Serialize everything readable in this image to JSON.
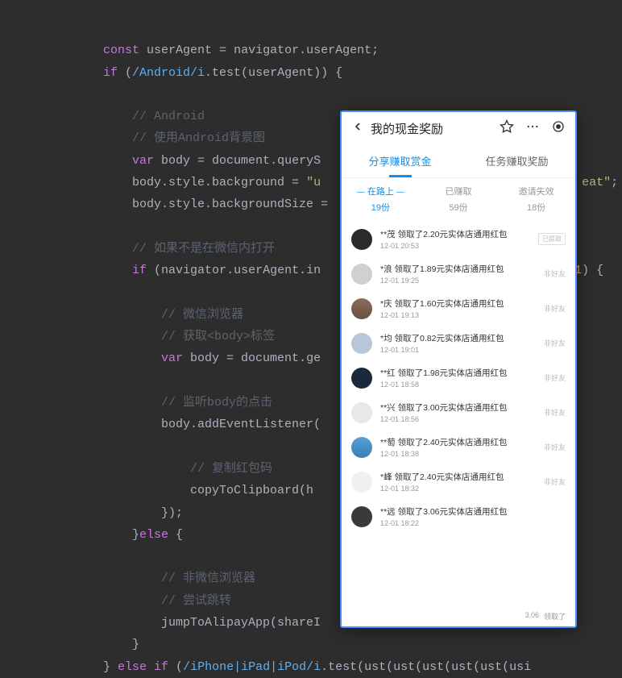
{
  "code": {
    "l1": {
      "const": "const",
      "userAgent": "userAgent",
      "eq": " = ",
      "nav": "navigator",
      "dot": ".",
      "ua": "userAgent",
      "semi": ";"
    },
    "l2": {
      "if": "if",
      "lp": " (",
      "regex": "/Android/i",
      "test": ".test(",
      "ua": "userAgent",
      "rp": ")) {"
    },
    "c1": "// Android",
    "c2": "// 使用Android背景图",
    "l5": {
      "var": "var",
      "body": " body = ",
      "doc": "document",
      "dot": ".",
      "qs": "queryS"
    },
    "l6": {
      "body": "body",
      "sb": ".style.background = ",
      "str": "\"u",
      "str2": "eat\"",
      "semi": ";"
    },
    "l7": {
      "body": "body",
      "sbs": ".style.backgroundSize ="
    },
    "c3": "// 如果不是在微信内打开",
    "l9": {
      "if": "if",
      "lp": " (",
      "nav": "navigator",
      "ua": ".userAgent.in",
      "num": "1",
      "rp": ") {"
    },
    "c4": "// 微信浏览器",
    "c5": "// 获取<body>标签",
    "l12": {
      "var": "var",
      "body": " body = ",
      "doc": "document",
      "ge": ".ge"
    },
    "c6": "// 监听body的点击",
    "l14": {
      "body": "body",
      "ael": ".addEventListener("
    },
    "c7": "// 复制红包码",
    "l16": {
      "ctc": "copyToClipboard(h"
    },
    "l17": {
      "brace": "})",
      "semi": ";"
    },
    "l18": {
      "rbrace": "}",
      "else": "else",
      "lbrace": " {"
    },
    "c8": "// 非微信浏览器",
    "c9": "// 尝试跳转",
    "l21": {
      "jta": "jumpToAlipayApp(shareI"
    },
    "l22": "}",
    "l23": {
      "rbrace": "} ",
      "else": "else",
      "if": " if",
      "lp": " (",
      "regex": "/iPhone|iPad|iPod/i",
      "tail": ".test(ust(ust(ust(ust(ust(usi"
    }
  },
  "phone": {
    "header": {
      "title": "我的现金奖励"
    },
    "tabs": [
      {
        "label": "分享赚取赏金",
        "active": true
      },
      {
        "label": "任务赚取奖励",
        "active": false
      }
    ],
    "status": [
      {
        "label": "在路上",
        "count": "19份",
        "active": true
      },
      {
        "label": "已赚取",
        "count": "59份",
        "active": false
      },
      {
        "label": "邀请失效",
        "count": "18份",
        "active": false
      }
    ],
    "rewards": [
      {
        "name": "**茂 领取了2.20元实体店通用红包",
        "time": "12-01 20:53",
        "badge": "已提取",
        "avatar": "c1"
      },
      {
        "name": "*浪 领取了1.89元实体店通用红包",
        "time": "12-01 19:25",
        "tag": "非好友",
        "avatar": "c2"
      },
      {
        "name": "*庆 领取了1.60元实体店通用红包",
        "time": "12-01 19:13",
        "tag": "非好友",
        "avatar": "c3"
      },
      {
        "name": "*均 领取了0.82元实体店通用红包",
        "time": "12-01 19:01",
        "tag": "非好友",
        "avatar": "c4"
      },
      {
        "name": "**红 领取了1.98元实体店通用红包",
        "time": "12-01 18:58",
        "tag": "非好友",
        "avatar": "c5"
      },
      {
        "name": "**兴 领取了3.00元实体店通用红包",
        "time": "12-01 18:56",
        "tag": "非好友",
        "avatar": "c6"
      },
      {
        "name": "**萄 领取了2.40元实体店通用红包",
        "time": "12-01 18:38",
        "tag": "非好友",
        "avatar": "c7"
      },
      {
        "name": "*峰 领取了2.40元实体店通用红包",
        "time": "12-01 18:32",
        "tag": "非好友",
        "avatar": "c8"
      },
      {
        "name": "**远 领取了3.06元实体店通用红包",
        "time": "12-01 18:22",
        "avatar": "c9"
      }
    ],
    "bottom": {
      "a": "3.06",
      "b": "领取了"
    }
  }
}
